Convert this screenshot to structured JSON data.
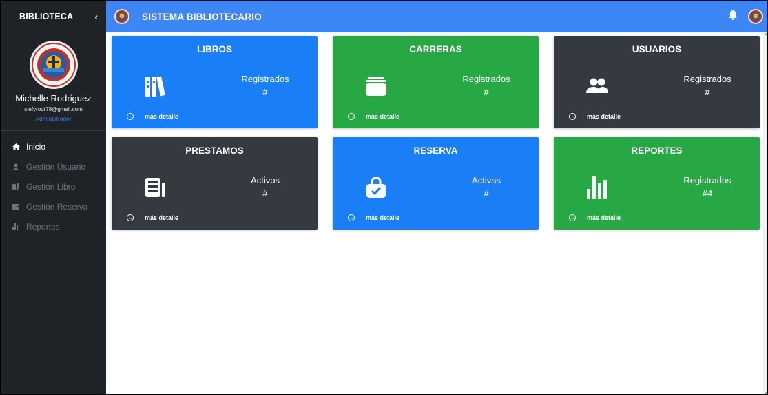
{
  "sidebar": {
    "brand": "BIBLIOTECA",
    "toggle": "‹",
    "profile": {
      "name": "Michelle Rodriguez",
      "email": "stefyrodr78@gmail.com",
      "role": "Administrador"
    },
    "nav": [
      {
        "label": "Inicio",
        "icon": "home-icon",
        "active": true
      },
      {
        "label": "Gestión Usuario",
        "icon": "user-icon",
        "active": false
      },
      {
        "label": "Gestión Libro",
        "icon": "books-icon",
        "active": false
      },
      {
        "label": "Gestión Reserva",
        "icon": "wallet-icon",
        "active": false
      },
      {
        "label": "Reportes",
        "icon": "chart-icon",
        "active": false
      }
    ]
  },
  "header": {
    "title": "SISTEMA BIBLIOTECARIO"
  },
  "cards": [
    {
      "title": "LIBROS",
      "stat_label": "Registrados",
      "stat_value": "#",
      "footer": "más detalle",
      "icon": "books-icon",
      "color": "#1a7ff7"
    },
    {
      "title": "CARRERAS",
      "stat_label": "Registrados",
      "stat_value": "#",
      "footer": "más detalle",
      "icon": "wallet-icon",
      "color": "#28a745"
    },
    {
      "title": "USUARIOS",
      "stat_label": "Registrados",
      "stat_value": "#",
      "footer": "más detalle",
      "icon": "users-icon",
      "color": "#343a40"
    },
    {
      "title": "PRESTAMOS",
      "stat_label": "Activos",
      "stat_value": "#",
      "footer": "más detalle",
      "icon": "newspaper-icon",
      "color": "#343a40"
    },
    {
      "title": "RESERVA",
      "stat_label": "Activas",
      "stat_value": "#",
      "footer": "más detalle",
      "icon": "shopping-bag-check-icon",
      "color": "#1a7ff7"
    },
    {
      "title": "REPORTES",
      "stat_label": "Registrados",
      "stat_value": "#4",
      "footer": "más detalle",
      "icon": "bar-chart-icon",
      "color": "#28a745"
    }
  ]
}
